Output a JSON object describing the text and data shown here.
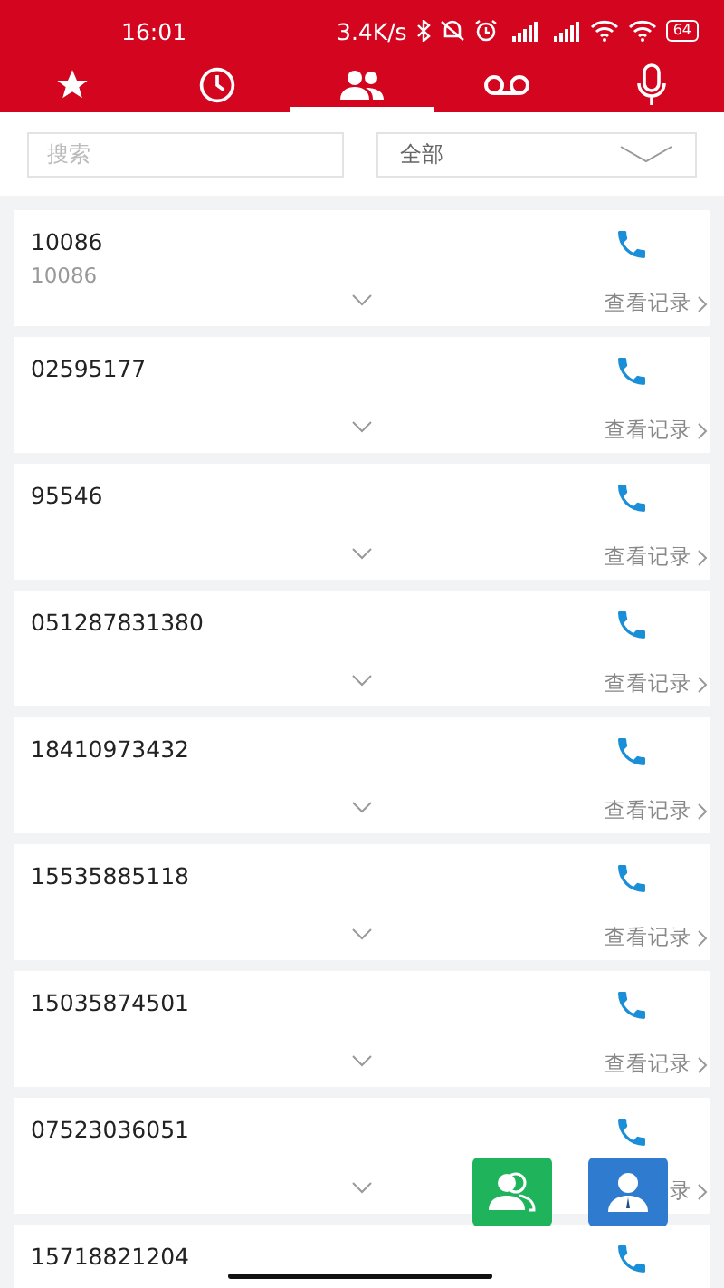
{
  "status_bar": {
    "time": "16:01",
    "speed": "3.4K/s",
    "battery": "64"
  },
  "tabs": [
    {
      "kind": "favorites",
      "selected": false
    },
    {
      "kind": "recents",
      "selected": false
    },
    {
      "kind": "contacts",
      "selected": true
    },
    {
      "kind": "voicemail",
      "selected": false
    },
    {
      "kind": "voice",
      "selected": false
    }
  ],
  "search": {
    "placeholder": "搜索"
  },
  "filter": {
    "value": "全部"
  },
  "contacts": [
    {
      "number": "10086",
      "subtitle": "10086",
      "records": "查看记录"
    },
    {
      "number": "02595177",
      "records": "查看记录"
    },
    {
      "number": "95546",
      "records": "查看记录"
    },
    {
      "number": "051287831380",
      "records": "查看记录"
    },
    {
      "number": "18410973432",
      "records": "查看记录"
    },
    {
      "number": "15535885118",
      "records": "查看记录"
    },
    {
      "number": "15035874501",
      "records": "查看记录"
    },
    {
      "number": "07523036051",
      "records": "录"
    },
    {
      "number": "15718821204"
    }
  ],
  "actions": [
    {
      "kind": "group"
    },
    {
      "kind": "person"
    }
  ]
}
